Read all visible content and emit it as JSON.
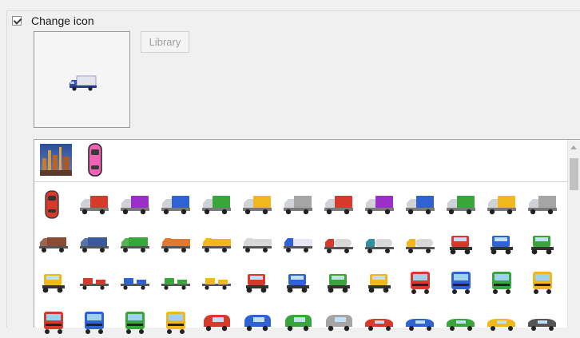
{
  "change_icon": {
    "label": "Change icon",
    "checked": true
  },
  "library_button": {
    "label": "Library"
  },
  "preview": {
    "icon": "delivery-truck-white-icon"
  },
  "recent_icons": [
    {
      "name": "city-photo-icon"
    },
    {
      "name": "pink-car-top-icon"
    }
  ],
  "icon_rows": [
    [
      "red-car-top-icon",
      "red-box-truck-icon",
      "purple-box-truck-icon",
      "blue-box-truck-icon",
      "green-box-truck-icon",
      "yellow-box-truck-icon",
      "gray-box-truck-icon",
      "red-box-truck-icon",
      "purple-box-truck-icon",
      "blue-box-truck-icon",
      "green-box-truck-icon",
      "yellow-box-truck-icon",
      "gray-box-truck-icon"
    ],
    [
      "brown-truck-icon",
      "navy-truck-icon",
      "green-truck-icon",
      "orange-flatbed-icon",
      "yellow-flatbed-icon",
      "white-flatbed-icon",
      "blue-delivery-truck-icon",
      "red-tanker-icon",
      "teal-tanker-icon",
      "yellow-tanker-icon",
      "red-semi-icon",
      "blue-semi-icon",
      "green-semi-icon"
    ],
    [
      "yellow-loader-icon",
      "red-tractor-icon",
      "blue-tractor-icon",
      "green-tractor-icon",
      "yellow-tractor-icon",
      "red-semi-front-icon",
      "blue-semi-front-icon",
      "green-semi-front-icon",
      "yellow-semi-front-icon",
      "red-cab-icon",
      "blue-cab-icon",
      "green-cab-icon",
      "yellow-cab-icon"
    ],
    [
      "red-truck-front-icon",
      "blue-truck-front-icon",
      "green-truck-front-icon",
      "yellow-truck-front-icon",
      "red-van-icon",
      "blue-van-icon",
      "green-van-icon",
      "gray-van-icon",
      "red-low-car-icon",
      "blue-low-car-icon",
      "green-low-car-icon",
      "yellow-low-car-icon",
      "dark-low-car-icon"
    ]
  ],
  "colors": {
    "red": "#d73a2a",
    "purple": "#9b2fc8",
    "blue": "#2f63d3",
    "green": "#3aa53a",
    "yellow": "#f0b81d",
    "gray": "#a5a5a5",
    "brown": "#8a4a33",
    "navy": "#3b5a9a",
    "olive": "#5c7a3a",
    "orange": "#e07a30",
    "white": "#d8d8d8",
    "teal": "#2f8fa3",
    "dark": "#555555",
    "pink": "#f062b4"
  }
}
